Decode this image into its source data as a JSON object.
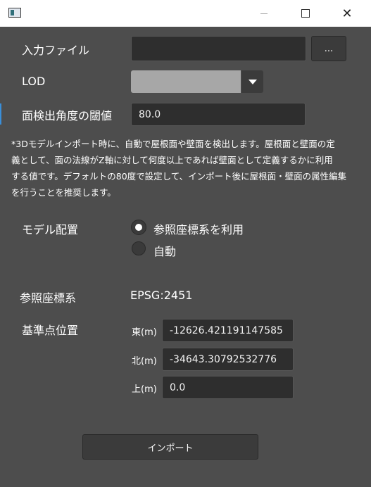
{
  "titlebar": {
    "close_glyph": "✕"
  },
  "form": {
    "input_file_label": "入力ファイル",
    "input_file_value": "",
    "browse_label": "...",
    "lod_label": "LOD",
    "lod_value": "",
    "threshold_label": "面検出角度の閾値",
    "threshold_value": "80.0",
    "description_lines": [
      "*3Dモデルインポート時に、自動で屋根面や壁面を検出します。屋根面と壁面の定",
      "義として、面の法線がZ軸に対して何度以上であれば壁面として定義するかに利用",
      "する値です。デフォルトの80度で設定して、インポート後に屋根面・壁面の属性編集",
      "を行うことを推奨します。"
    ],
    "model_placement_label": "モデル配置",
    "radio_reference_label": "参照座標系を利用",
    "radio_auto_label": "自動",
    "reference_crs_label": "参照座標系",
    "reference_crs_value": "EPSG:2451",
    "base_point_label": "基準点位置",
    "east_label": "東(m)",
    "east_value": "-12626.421191147585",
    "north_label": "北(m)",
    "north_value": "-34643.30792532776",
    "up_label": "上(m)",
    "up_value": "0.0",
    "import_button": "インポート"
  }
}
